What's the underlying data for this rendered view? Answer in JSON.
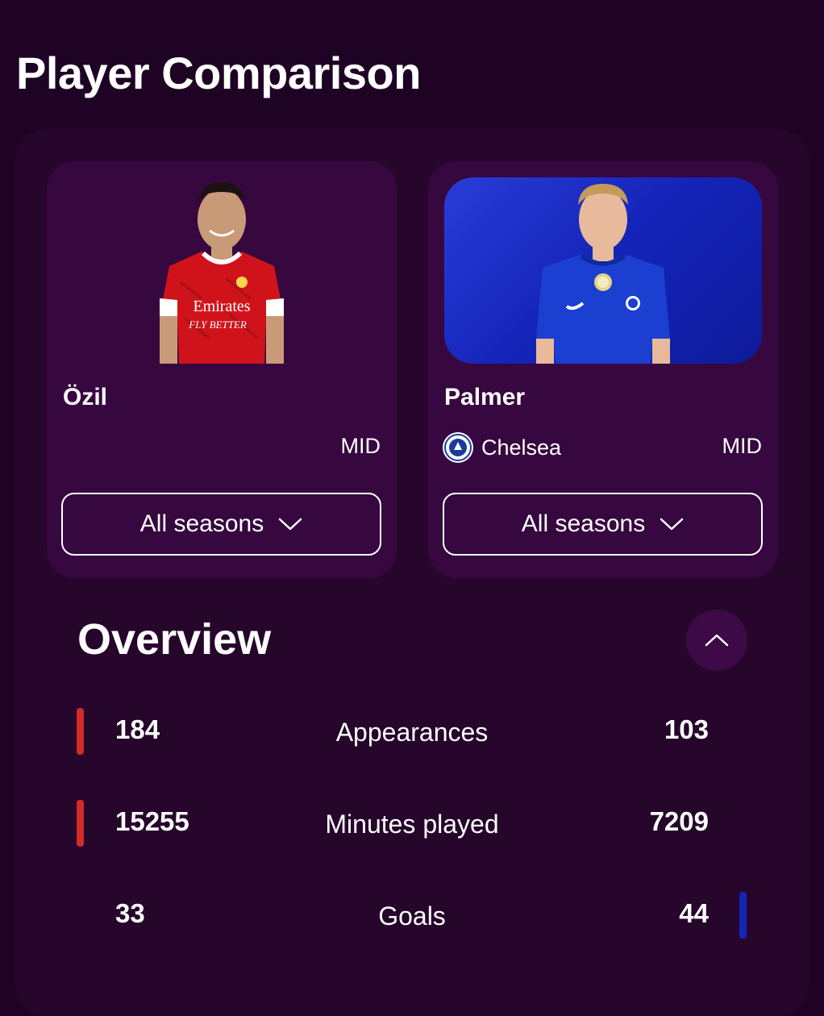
{
  "page": {
    "title": "Player Comparison"
  },
  "players": [
    {
      "name": "Özil",
      "club": "",
      "position": "MID",
      "season_label": "All seasons",
      "shirt_sponsor": "Emirates",
      "shirt_slogan": "FLY BETTER",
      "colors": {
        "shirt": "#d0131b",
        "card": "#37073f"
      }
    },
    {
      "name": "Palmer",
      "club": "Chelsea",
      "position": "MID",
      "season_label": "All seasons",
      "colors": {
        "shirt": "#1b3fd0",
        "photo_bg": "#1e30c8"
      }
    }
  ],
  "overview": {
    "title": "Overview",
    "collapse_icon": "chevron-up-icon",
    "stats": [
      {
        "label": "Appearances",
        "left": "184",
        "right": "103",
        "leader": "left"
      },
      {
        "label": "Minutes played",
        "left": "15255",
        "right": "7209",
        "leader": "left"
      },
      {
        "label": "Goals",
        "left": "33",
        "right": "44",
        "leader": "right"
      }
    ]
  },
  "colors": {
    "background": "#1f0324",
    "panel": "#26062b",
    "card": "#37073f",
    "left_accent": "#d42a2a",
    "right_accent": "#1326b8"
  }
}
